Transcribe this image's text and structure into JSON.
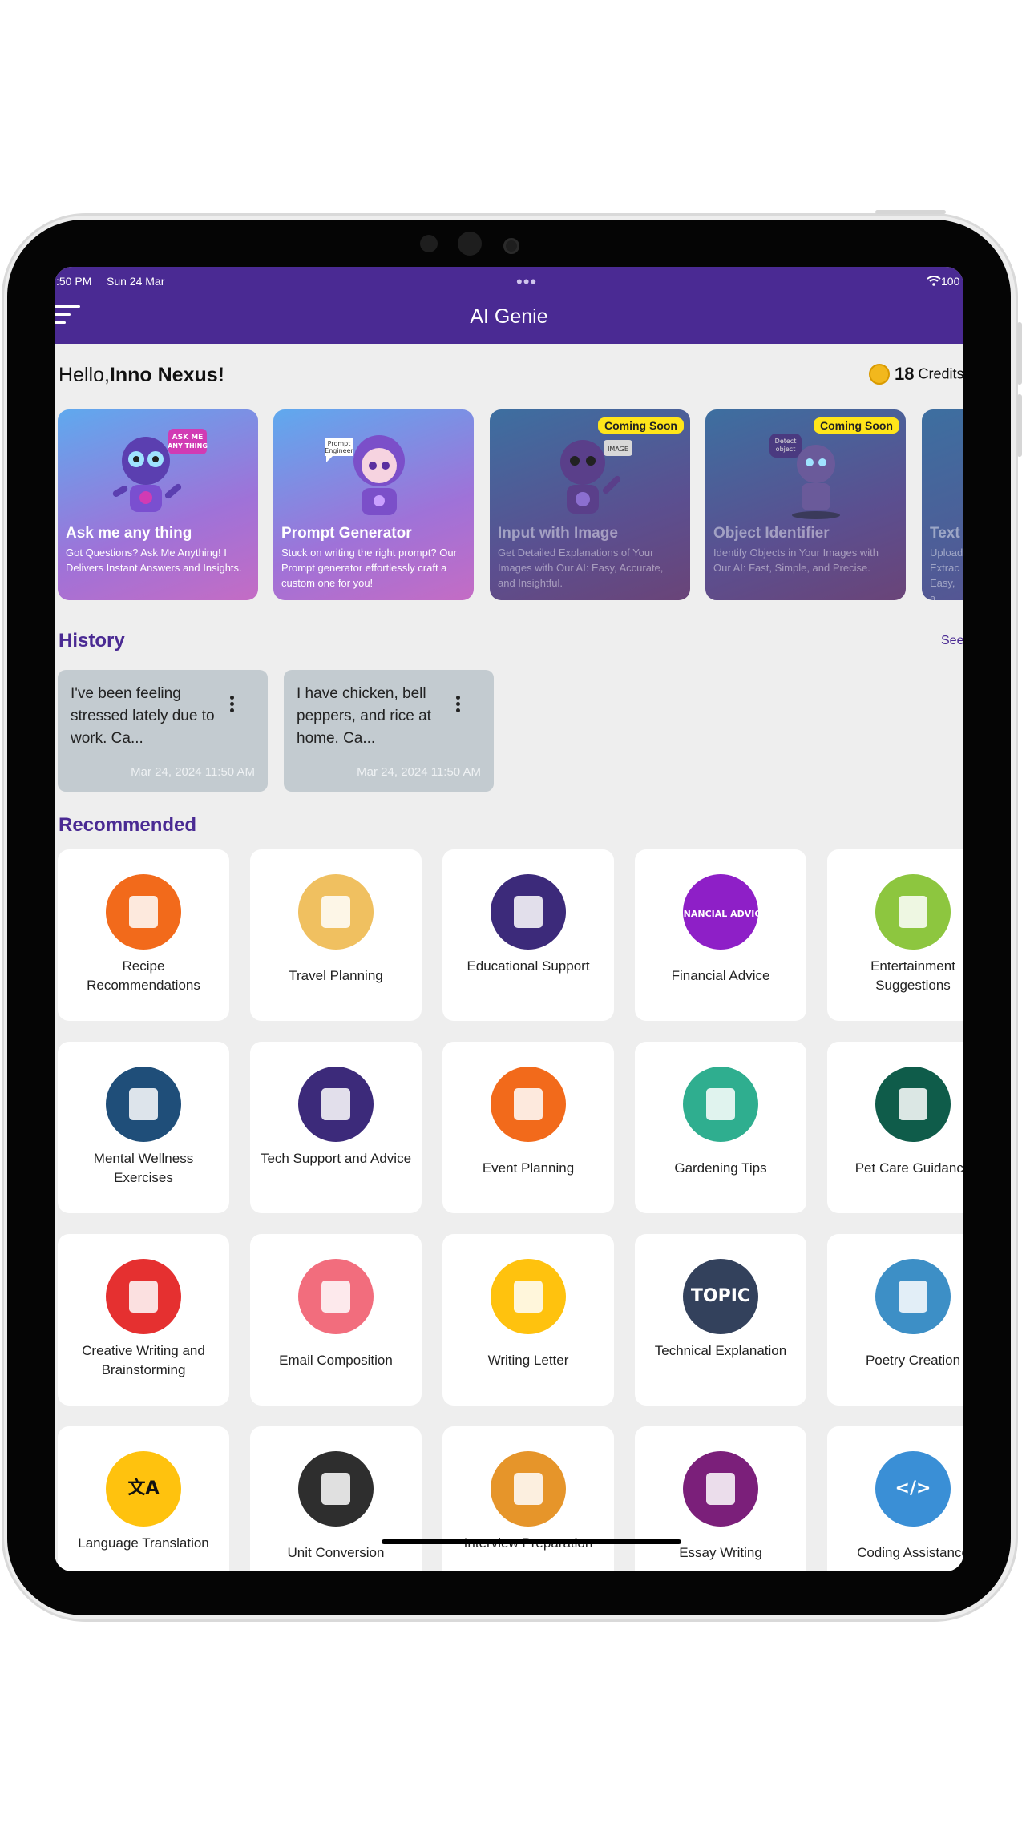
{
  "status_bar": {
    "time": ":50 PM",
    "date": "Sun 24 Mar",
    "battery": "100"
  },
  "header": {
    "title": "AI Genie"
  },
  "greeting": {
    "prefix": "Hello,",
    "name": "Inno Nexus!"
  },
  "credits": {
    "amount": "18",
    "label": "Credits"
  },
  "features": [
    {
      "title": "Ask me any thing",
      "desc": "Got Questions? Ask Me Anything! I Delivers Instant Answers and Insights.",
      "badge": "",
      "speech": "ASK ME ANY THING"
    },
    {
      "title": "Prompt Generator",
      "desc": "Stuck on writing the right prompt? Our Prompt generator effortlessly craft a custom one for you!",
      "badge": "",
      "speech": "Prompt Engineer"
    },
    {
      "title": "Input with Image",
      "desc": "Get Detailed Explanations of Your Images with Our AI: Easy, Accurate, and Insightful.",
      "badge": "Coming Soon",
      "speech": "IMAGE"
    },
    {
      "title": "Object Identifier",
      "desc": "Identify Objects in Your Images with Our AI: Fast, Simple, and Precise.",
      "badge": "Coming Soon",
      "speech": "Detect object"
    },
    {
      "title": "Text",
      "desc": "Upload Extrac Easy, a",
      "badge": "",
      "speech": ""
    }
  ],
  "history": {
    "title": "History",
    "see_all": "See",
    "items": [
      {
        "text": "I've been feeling stressed lately due to work. Ca...",
        "date": "Mar 24, 2024 11:50 AM"
      },
      {
        "text": "I have chicken, bell peppers, and rice at home. Ca...",
        "date": "Mar 24, 2024 11:50 AM"
      }
    ]
  },
  "recommended": {
    "title": "Recommended",
    "items": [
      {
        "label": "Recipe Recommendations",
        "icon": "recipe-icon",
        "color": "#f26a1b"
      },
      {
        "label": "Travel Planning",
        "icon": "suitcase-icon",
        "color": "#f0c060"
      },
      {
        "label": "Educational Support",
        "icon": "book-hand-icon",
        "color": "#3c2a7a"
      },
      {
        "label": "Financial Advice",
        "icon": "financial-advice-icon",
        "color": "#8e1fc7",
        "text": "FINANCIAL ADVICE"
      },
      {
        "label": "Entertainment Suggestions",
        "icon": "confetti-icon",
        "color": "#8dc63f"
      },
      {
        "label": "Mental Wellness Exercises",
        "icon": "brain-bulb-icon",
        "color": "#1f4e79"
      },
      {
        "label": "Tech Support and Advice",
        "icon": "book-hand-icon",
        "color": "#3c2a7a"
      },
      {
        "label": "Event Planning",
        "icon": "calendar-icon",
        "color": "#f26a1b"
      },
      {
        "label": "Gardening Tips",
        "icon": "garden-tools-icon",
        "color": "#2fae8f"
      },
      {
        "label": "Pet Care Guidance",
        "icon": "pet-house-icon",
        "color": "#0f5c4a"
      },
      {
        "label": "Creative Writing and Brainstorming",
        "icon": "writing-pad-icon",
        "color": "#e53030"
      },
      {
        "label": "Email Composition",
        "icon": "email-pen-icon",
        "color": "#f26d7d"
      },
      {
        "label": "Writing Letter",
        "icon": "letter-icon",
        "color": "#ffc20e"
      },
      {
        "label": "Technical Explanation",
        "icon": "topic-doc-icon",
        "color": "#33415c",
        "text": "TOPIC"
      },
      {
        "label": "Poetry Creation",
        "icon": "quill-icon",
        "color": "#3d8fc6"
      },
      {
        "label": "Language Translation",
        "icon": "translate-icon",
        "color": "#ffc20e",
        "text": "文A"
      },
      {
        "label": "Unit Conversion",
        "icon": "convert-icon",
        "color": "#2e2e2e"
      },
      {
        "label": "Interview Preparation",
        "icon": "interview-icon",
        "color": "#e6952a"
      },
      {
        "label": "Essay Writing",
        "icon": "essay-icon",
        "color": "#7b1f7a"
      },
      {
        "label": "Coding Assistance",
        "icon": "code-window-icon",
        "color": "#3a8fd6",
        "text": "</>"
      }
    ]
  }
}
